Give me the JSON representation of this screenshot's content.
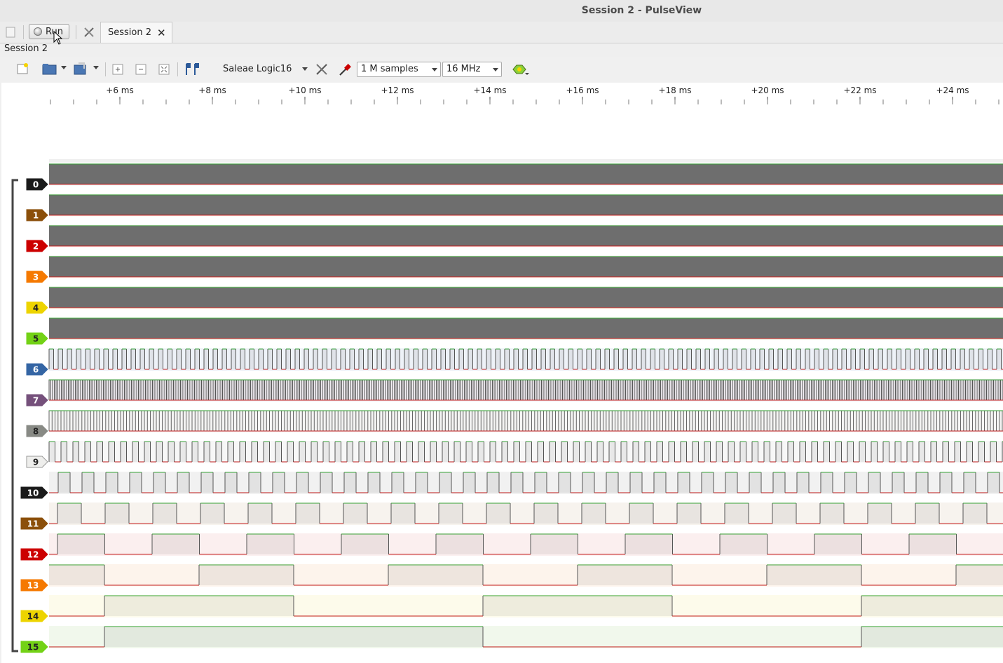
{
  "window": {
    "title": "Session 2 - PulseView"
  },
  "tabs": {
    "run_label": "Run",
    "session_tab_label": "Session 2",
    "session_tab_close": "✕"
  },
  "session": {
    "label": "Session 2"
  },
  "toolbar": {
    "device": "Saleae Logic16",
    "samples": "1 M samples",
    "samplerate": "16 MHz"
  },
  "ruler": {
    "ticks": [
      "+6 ms",
      "+8 ms",
      "+10 ms",
      "+12 ms",
      "+14 ms",
      "+16 ms",
      "+18 ms",
      "+20 ms",
      "+22 ms",
      "+24 ms"
    ]
  },
  "channels": [
    {
      "label": "0",
      "color": "#1a1a1a",
      "text": "#ffffff"
    },
    {
      "label": "1",
      "color": "#8b4f0a",
      "text": "#ffffff"
    },
    {
      "label": "2",
      "color": "#cc0000",
      "text": "#ffffff"
    },
    {
      "label": "3",
      "color": "#f57900",
      "text": "#ffffff"
    },
    {
      "label": "4",
      "color": "#edd400",
      "text": "#222222"
    },
    {
      "label": "5",
      "color": "#73d216",
      "text": "#222222"
    },
    {
      "label": "6",
      "color": "#3465a4",
      "text": "#ffffff"
    },
    {
      "label": "7",
      "color": "#75507b",
      "text": "#ffffff"
    },
    {
      "label": "8",
      "color": "#888a85",
      "text": "#222222"
    },
    {
      "label": "9",
      "color": "#eeeeec",
      "text": "#222222"
    },
    {
      "label": "10",
      "color": "#1a1a1a",
      "text": "#ffffff"
    },
    {
      "label": "11",
      "color": "#8b4f0a",
      "text": "#ffffff"
    },
    {
      "label": "12",
      "color": "#cc0000",
      "text": "#ffffff"
    },
    {
      "label": "13",
      "color": "#f57900",
      "text": "#ffffff"
    },
    {
      "label": "14",
      "color": "#edd400",
      "text": "#222222"
    },
    {
      "label": "15",
      "color": "#73d216",
      "text": "#222222"
    }
  ]
}
